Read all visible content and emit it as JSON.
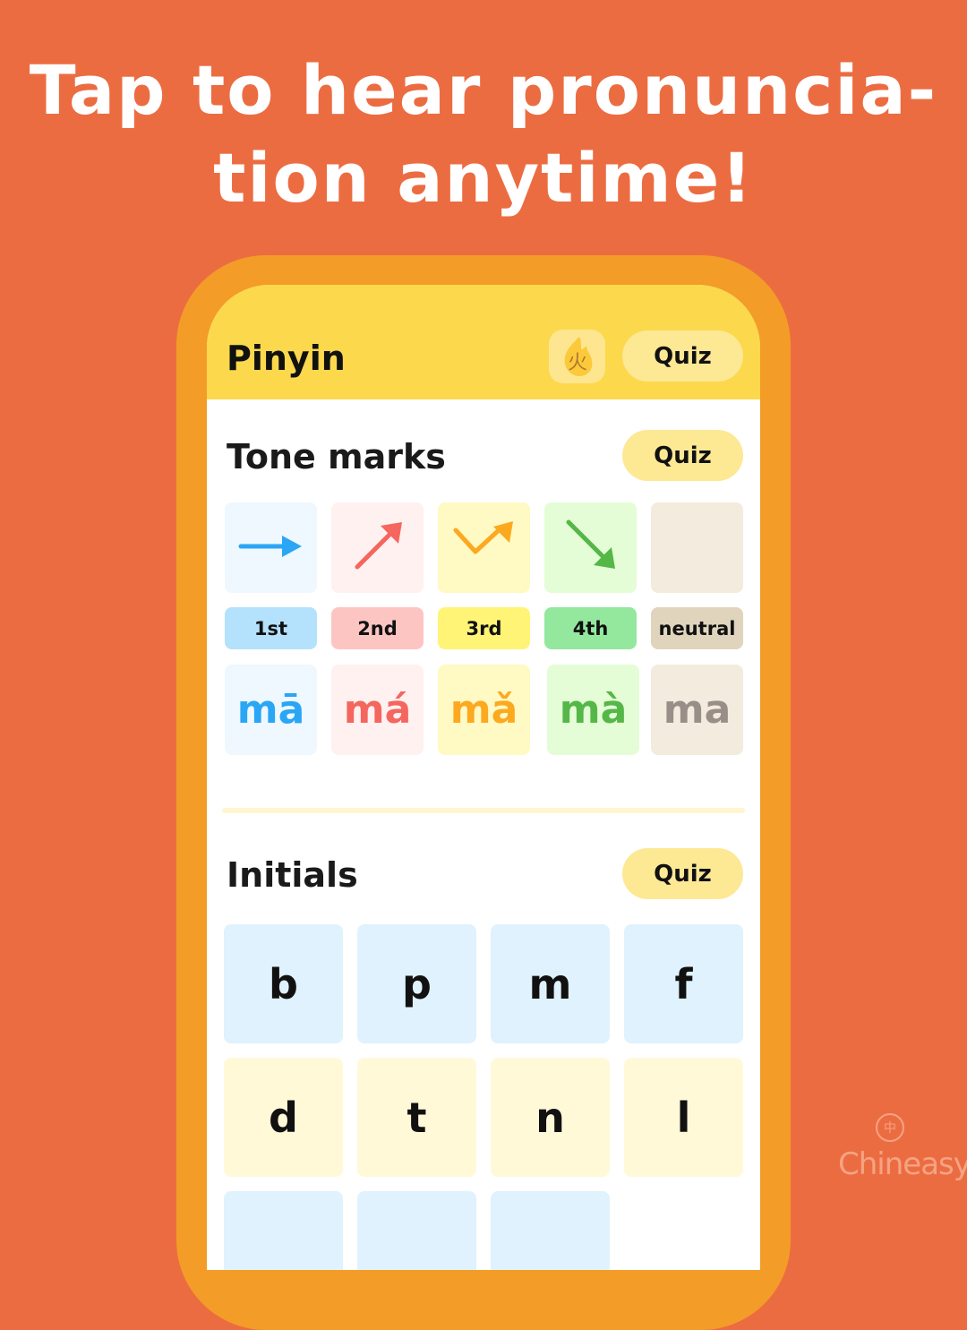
{
  "headline": {
    "line1": "Tap to hear pronuncia-",
    "line2": "tion anytime!"
  },
  "app": {
    "title": "Pinyin",
    "fire_icon_char": "火",
    "header_quiz_label": "Quiz"
  },
  "tone_marks": {
    "title": "Tone marks",
    "quiz_label": "Quiz",
    "tones": [
      {
        "label": "1st",
        "syllable": "mā",
        "icon": "arrow-right-icon",
        "color": "#2AA6F5",
        "card_bg": "#EEF8FE",
        "label_bg": "#B4E1FC"
      },
      {
        "label": "2nd",
        "syllable": "má",
        "icon": "arrow-up-right-icon",
        "color": "#F4665E",
        "card_bg": "#FFF1F0",
        "label_bg": "#FDC5C2"
      },
      {
        "label": "3rd",
        "syllable": "mǎ",
        "icon": "dip-rise-arrow-icon",
        "color": "#FCA91F",
        "card_bg": "#FFF9C4",
        "label_bg": "#FFF476"
      },
      {
        "label": "4th",
        "syllable": "mà",
        "icon": "arrow-down-right-icon",
        "color": "#55B748",
        "card_bg": "#E4FDD6",
        "label_bg": "#93E89E"
      },
      {
        "label": "neutral",
        "syllable": "ma",
        "icon": "none",
        "color": "#9A8E88",
        "card_bg": "#F3EBDD",
        "label_bg": "#E0D4BD"
      }
    ]
  },
  "initials": {
    "title": "Initials",
    "quiz_label": "Quiz",
    "rows": [
      [
        "b",
        "p",
        "m",
        "f"
      ],
      [
        "d",
        "t",
        "n",
        "l"
      ],
      [
        "",
        "",
        ""
      ]
    ]
  },
  "brand": {
    "name": "Chineasy",
    "mark": "®",
    "logo_char": "中"
  }
}
